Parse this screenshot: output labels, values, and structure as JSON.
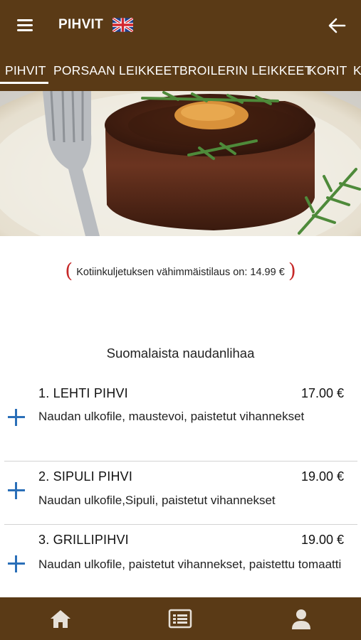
{
  "header": {
    "title": "PIHVIT",
    "language_flag": "uk-flag-icon",
    "menu_icon": "hamburger-menu-icon",
    "back_icon": "arrow-left-icon"
  },
  "tabs": [
    {
      "label": "PIHVIT",
      "active": true
    },
    {
      "label": "PORSAAN LEIKKEET",
      "active": false
    },
    {
      "label": "BROILERIN LEIKKEET",
      "active": false
    },
    {
      "label": "KORIT",
      "active": false
    },
    {
      "label": "K",
      "active": false
    }
  ],
  "min_order": {
    "text": "Kotiinkuljetuksen vähimmäistilaus on: 14.99 €"
  },
  "section": {
    "title": "Suomalaista naudanlihaa"
  },
  "items": [
    {
      "name": "1. LEHTI PIHVI",
      "price": "17.00 €",
      "description": "Naudan ulkofile, maustevoi, paistetut vihannekset"
    },
    {
      "name": "2. SIPULI PIHVI",
      "price": "19.00 €",
      "description": "Naudan ulkofile,Sipuli, paistetut vihannekset"
    },
    {
      "name": "3. GRILLIPIHVI",
      "price": "19.00 €",
      "description": "Naudan ulkofile, paistetut vihannekset, paistettu tomaatti"
    }
  ],
  "bottom_nav": [
    {
      "icon": "home-icon"
    },
    {
      "icon": "menu-list-icon"
    },
    {
      "icon": "user-icon"
    }
  ],
  "colors": {
    "brand_brown": "#5a3a16",
    "add_blue": "#2a6fb8",
    "accent_red": "#c62828"
  }
}
